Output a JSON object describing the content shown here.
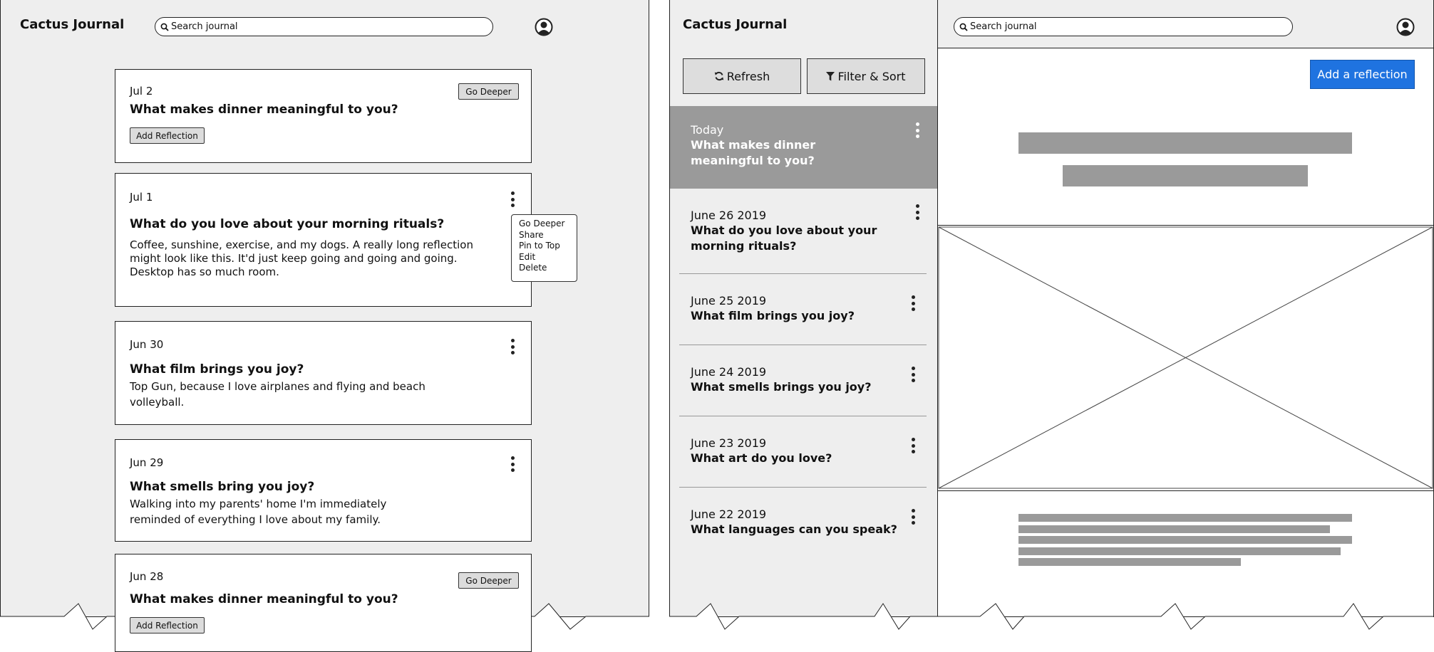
{
  "app": {
    "title": "Cactus Journal"
  },
  "search": {
    "placeholder": "Search journal"
  },
  "mobile": {
    "cards": [
      {
        "date": "Jul 2",
        "question": "What makes dinner meaningful to you?",
        "action": "Go Deeper",
        "add": "Add Reflection"
      },
      {
        "date": "Jul 1",
        "question": "What do you love about your morning rituals?",
        "body": "Coffee, sunshine, exercise, and my dogs. A really long reflection might look like this. It'd just keep going and going and going. Desktop has so much room."
      },
      {
        "date": "Jun 30",
        "question": "What film brings you joy?",
        "body": "Top Gun, because I love airplanes and flying and beach volleyball."
      },
      {
        "date": "Jun 29",
        "question": "What smells bring you joy?",
        "body": "Walking into my parents' home I'm immediately reminded of everything I love about my family."
      },
      {
        "date": "Jun 28",
        "question": "What makes dinner meaningful to you?",
        "action": "Go Deeper",
        "add": "Add Reflection"
      }
    ],
    "menu": [
      "Go Deeper",
      "Share",
      "Pin to Top",
      "Edit",
      "Delete"
    ]
  },
  "desktop": {
    "refresh": "Refresh",
    "filter": "Filter & Sort",
    "add_reflection": "Add a reflection",
    "list": [
      {
        "date": "Today",
        "question": "What makes dinner meaningful to you?",
        "selected": true
      },
      {
        "date": "June 26 2019",
        "question": "What do you love about your morning rituals?"
      },
      {
        "date": "June 25 2019",
        "question": "What film brings you joy?"
      },
      {
        "date": "June 24 2019",
        "question": "What smells brings you joy?"
      },
      {
        "date": "June 23 2019",
        "question": "What art do you love?"
      },
      {
        "date": "June 22 2019",
        "question": "What languages can you speak?"
      }
    ]
  },
  "colors": {
    "accent": "#1f73e0",
    "panel": "#eeeeee",
    "selected": "#9a9a9a"
  }
}
